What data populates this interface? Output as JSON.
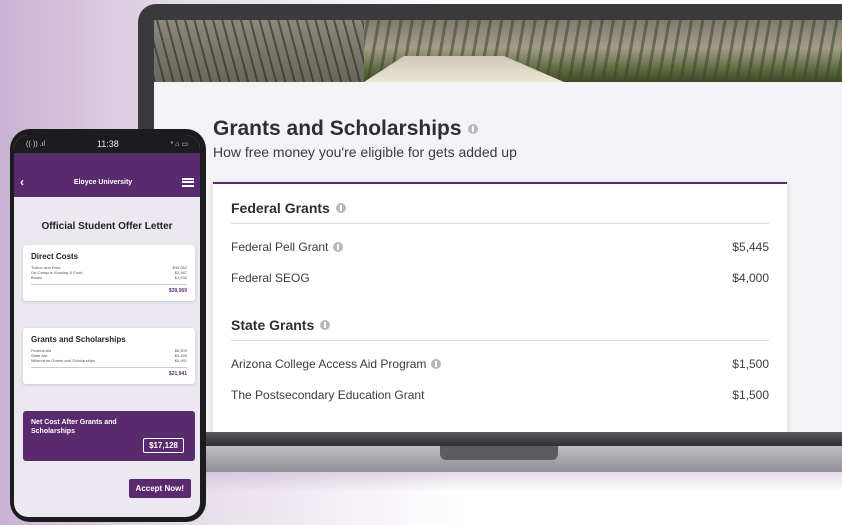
{
  "laptop": {
    "page_title": "Grants and Scholarships",
    "page_subtitle": "How free money you're eligible for gets added up",
    "sections": [
      {
        "heading": "Federal Grants",
        "rows": [
          {
            "name": "Federal Pell Grant",
            "amount": "$5,445",
            "info": true
          },
          {
            "name": "Federal SEOG",
            "amount": "$4,000",
            "info": false
          }
        ]
      },
      {
        "heading": "State Grants",
        "rows": [
          {
            "name": "Arizona College Access Aid Program",
            "amount": "$1,500",
            "info": true
          },
          {
            "name": "The Postsecondary Education Grant",
            "amount": "$1,500",
            "info": false
          }
        ]
      }
    ]
  },
  "phone": {
    "status": {
      "signal": "((·)) .ıl",
      "time": "11:38",
      "battery": "* ⌂ ▭"
    },
    "app_title": "Eloyce University",
    "offer_title": "Official Student Offer Letter",
    "direct_costs": {
      "title": "Direct Costs",
      "rows": [
        {
          "label": "Tuition and Fees",
          "value": "$35,052"
        },
        {
          "label": "On-Campus Housing & Food",
          "value": "$2,487"
        },
        {
          "label": "Books",
          "value": "$1,530"
        }
      ],
      "total": "$39,069"
    },
    "grants": {
      "title": "Grants and Scholarships",
      "rows": [
        {
          "label": "Federal Aid",
          "value": "$6,500"
        },
        {
          "label": "State Aid",
          "value": "$9,450"
        },
        {
          "label": "Millennium Grants and Scholarships",
          "value": "$5,991"
        }
      ],
      "total": "$21,941"
    },
    "net_cost_label": "Net Cost After Grants and Scholarships",
    "net_cost_value": "$17,128",
    "accept_label": "Accept Now!"
  }
}
